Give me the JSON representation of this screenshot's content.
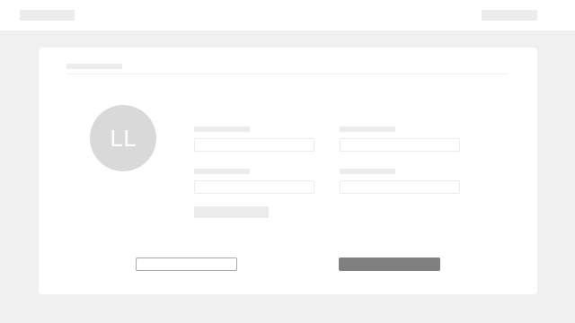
{
  "avatar": {
    "initials": "LL"
  },
  "form": {
    "fields": [
      {
        "value": "",
        "placeholder": ""
      },
      {
        "value": "",
        "placeholder": ""
      },
      {
        "value": "",
        "placeholder": ""
      },
      {
        "value": "",
        "placeholder": ""
      }
    ]
  },
  "colors": {
    "page_background": "#f0f0f0",
    "card_background": "#ffffff",
    "placeholder_block": "#ececec",
    "avatar_background": "#d9d9d9",
    "primary_button": "#808080",
    "secondary_button_border": "#a8a8a8"
  }
}
